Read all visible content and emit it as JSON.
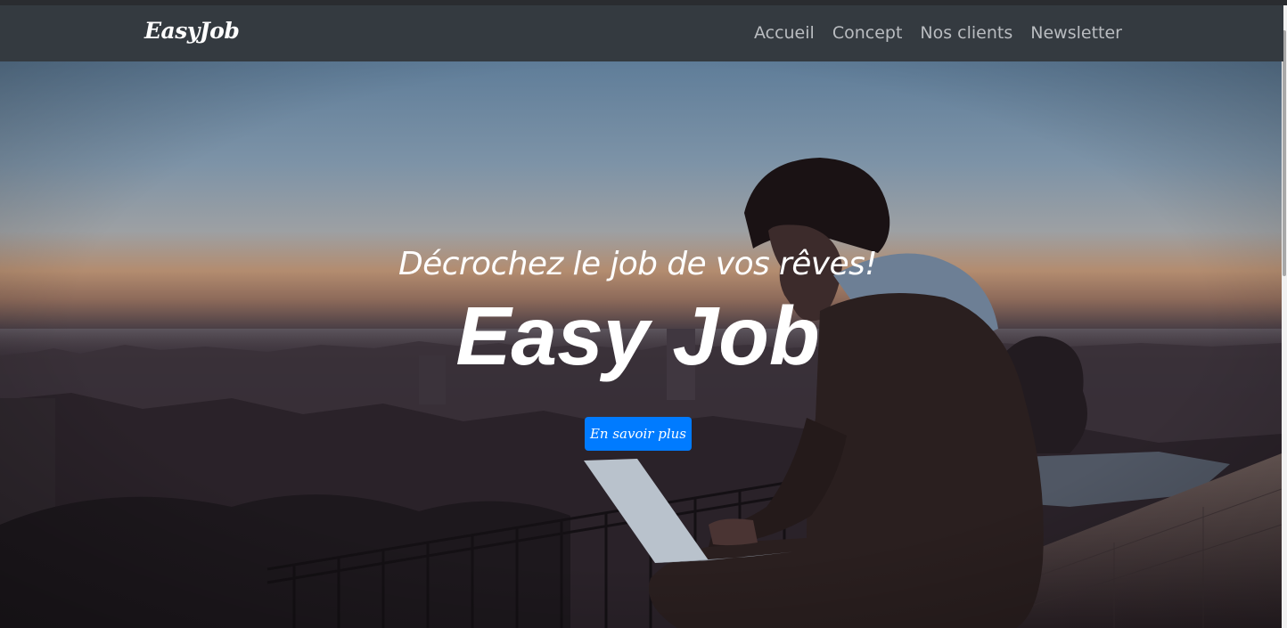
{
  "navbar": {
    "brand": "EasyJob",
    "links": [
      "Accueil",
      "Concept",
      "Nos clients",
      "Newsletter"
    ]
  },
  "hero": {
    "subtitle": "Décrochez le job de vos rêves!",
    "title": "Easy Job",
    "cta_label": "En savoir plus",
    "image": "person-with-laptop-city-sunset-photo"
  },
  "colors": {
    "navbar_bg": "#343a40",
    "nav_link": "#b9bcc0",
    "accent": "#007bff",
    "text_light": "#ffffff"
  }
}
